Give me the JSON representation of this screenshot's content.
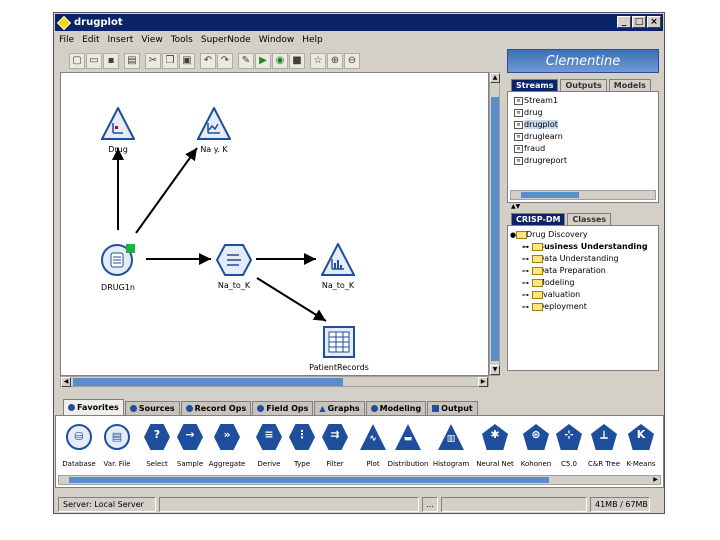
{
  "window": {
    "title": "drugplot"
  },
  "menu": [
    "File",
    "Edit",
    "Insert",
    "View",
    "Tools",
    "SuperNode",
    "Window",
    "Help"
  ],
  "toolbar": {
    "icons": [
      "new-icon",
      "open-icon",
      "save-icon",
      "print-icon",
      "cut-icon",
      "copy-icon",
      "paste-icon",
      "undo-icon",
      "redo-icon",
      "edit-icon",
      "run-icon",
      "run-selection-icon",
      "stop-icon",
      "favorite-icon",
      "zoom-in-icon",
      "zoom-out-icon"
    ]
  },
  "canvas": {
    "nodes": {
      "drug": "Drug",
      "nayk": "Na y. K",
      "drug1n": "DRUG1n",
      "natok_derive": "Na_to_K",
      "natok_hist": "Na_to_K",
      "patient": "PatientRecords"
    }
  },
  "right_panel": {
    "brand": "Clementine",
    "top_tabs": [
      "Streams",
      "Outputs",
      "Models"
    ],
    "streams": [
      "Stream1",
      "drug",
      "drugplot",
      "druglearn",
      "fraud",
      "drugreport"
    ],
    "selected_stream": "drugplot",
    "bottom_tabs": [
      "CRISP-DM",
      "Classes"
    ],
    "tree_root": "Drug Discovery",
    "tree_items": [
      "Business Understanding",
      "Data Understanding",
      "Data Preparation",
      "Modeling",
      "Evaluation",
      "Deployment"
    ]
  },
  "palette": {
    "tabs": [
      "Favorites",
      "Sources",
      "Record Ops",
      "Field Ops",
      "Graphs",
      "Modeling",
      "Output"
    ],
    "items": [
      "Database",
      "Var. File",
      "Select",
      "Sample",
      "Aggregate",
      "Derive",
      "Type",
      "Filter",
      "Plot",
      "Distribution",
      "Histogram",
      "Neural Net",
      "Kohonen",
      "C5.0",
      "C&R Tree",
      "K-Means"
    ]
  },
  "status": {
    "server": "Server: Local Server",
    "dots": "...",
    "memory": "41MB / 67MB"
  }
}
